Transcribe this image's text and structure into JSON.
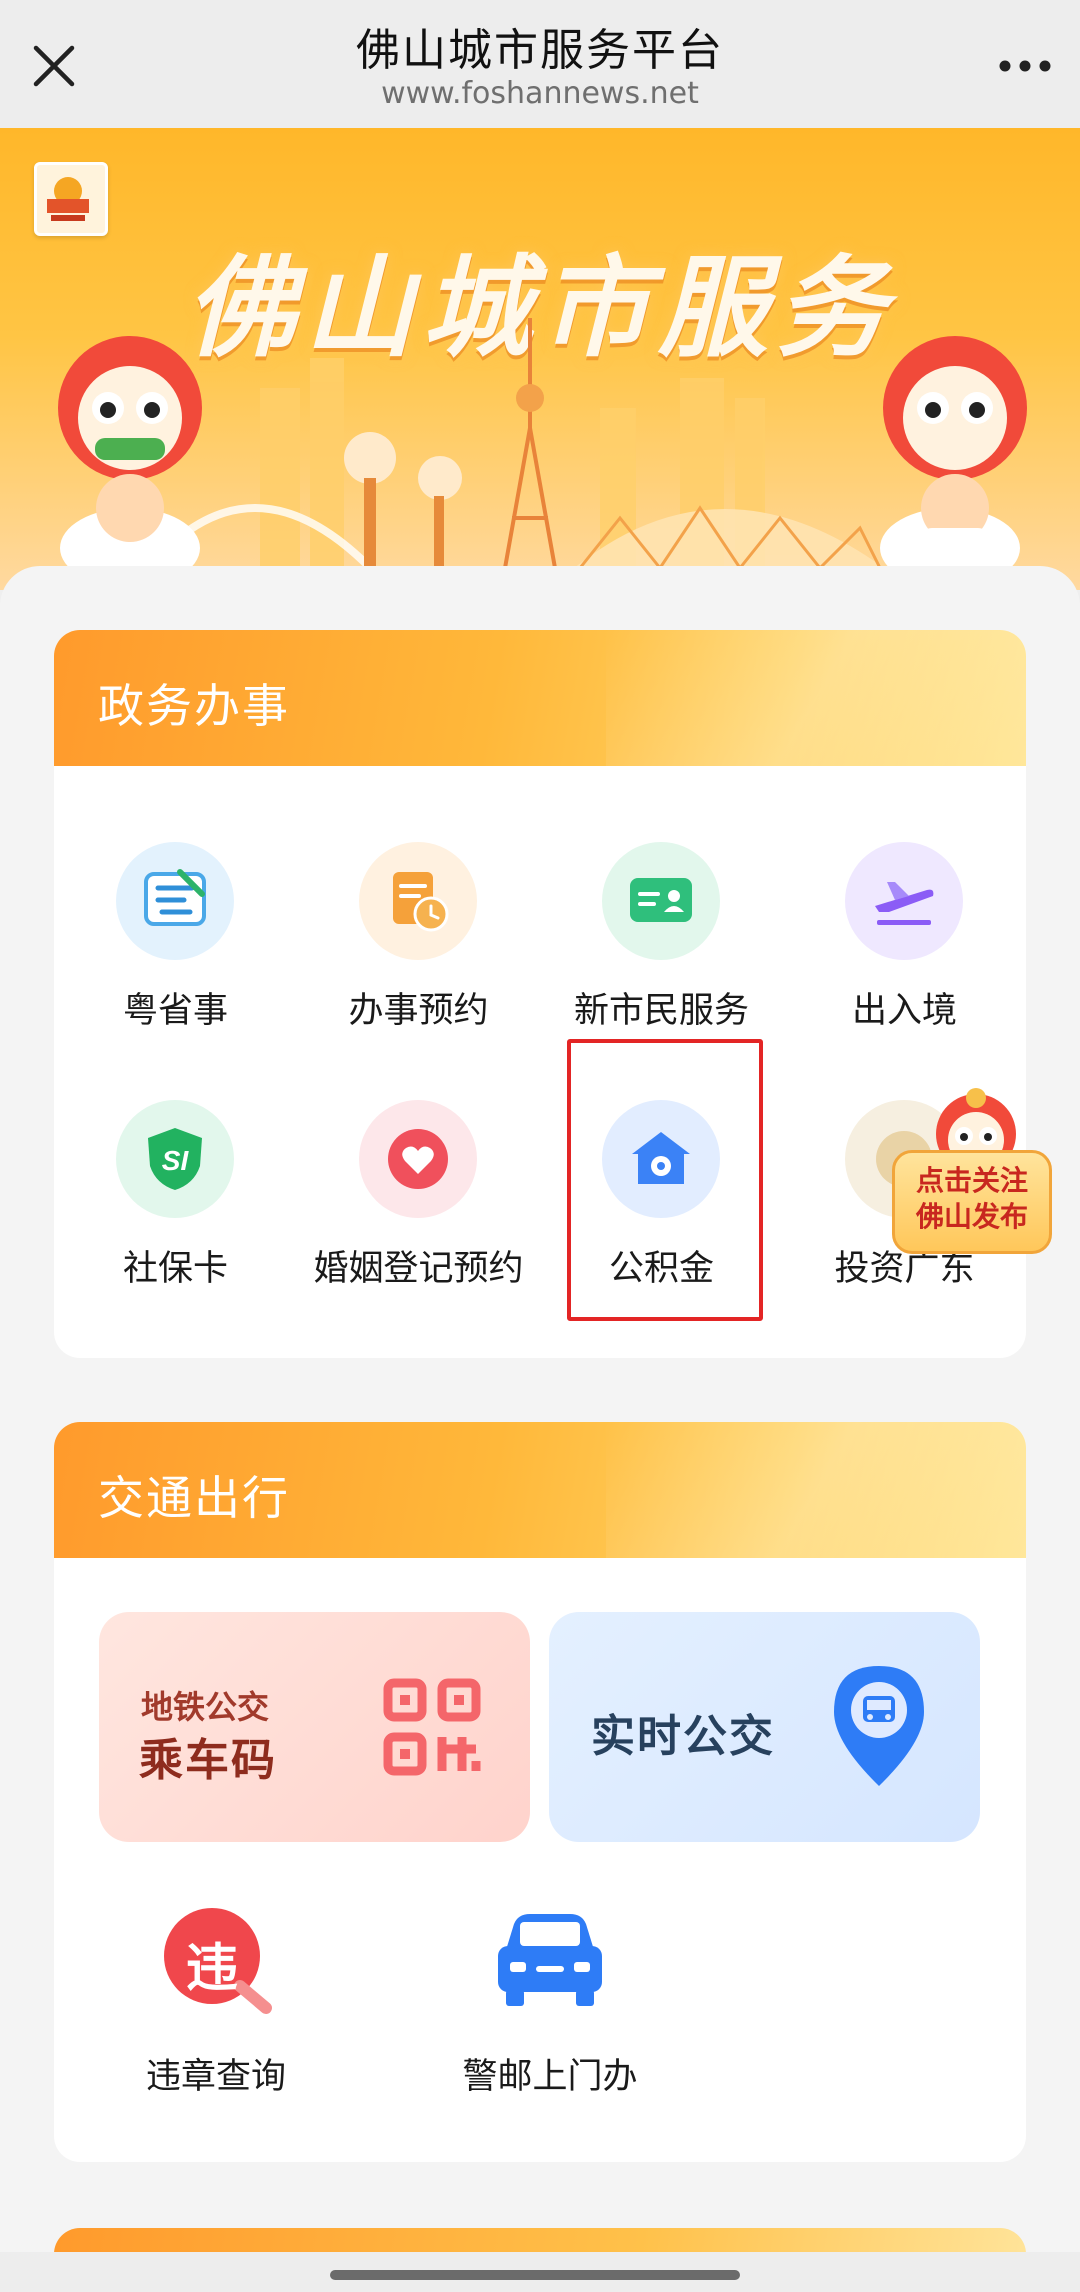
{
  "topbar": {
    "title": "佛山城市服务平台",
    "url": "www.foshannews.net",
    "close_icon": "close-icon",
    "more_icon": "more-icon"
  },
  "banner": {
    "title": "佛山城市服务"
  },
  "gov_section": {
    "title": "政务办事",
    "items": [
      {
        "label": "粤省事",
        "icon": "yue-icon",
        "color": "#3ea6e8"
      },
      {
        "label": "办事预约",
        "icon": "appointment-icon",
        "color": "#f0912a"
      },
      {
        "label": "新市民服务",
        "icon": "id-card-icon",
        "color": "#2fbf7c"
      },
      {
        "label": "出入境",
        "icon": "airplane-icon",
        "color": "#8b5cf6"
      },
      {
        "label": "社保卡",
        "icon": "shield-si-icon",
        "color": "#22b260"
      },
      {
        "label": "婚姻登记预约",
        "icon": "heart-icon",
        "color": "#f0505c"
      },
      {
        "label": "公积金",
        "icon": "home-fund-icon",
        "color": "#3b82f6"
      },
      {
        "label": "投资广东",
        "icon": "invest-icon",
        "color": "#e0b060"
      }
    ]
  },
  "float_badge": {
    "line1": "点击关注",
    "line2": "佛山发布"
  },
  "transport_section": {
    "title": "交通出行",
    "qr_tile": {
      "small": "地铁公交",
      "big": "乘车码"
    },
    "bus_tile": {
      "label": "实时公交"
    },
    "items": [
      {
        "label": "违章查询",
        "icon": "violation-icon"
      },
      {
        "label": "警邮上门办",
        "icon": "car-icon"
      }
    ]
  },
  "violation_glyph": "违"
}
